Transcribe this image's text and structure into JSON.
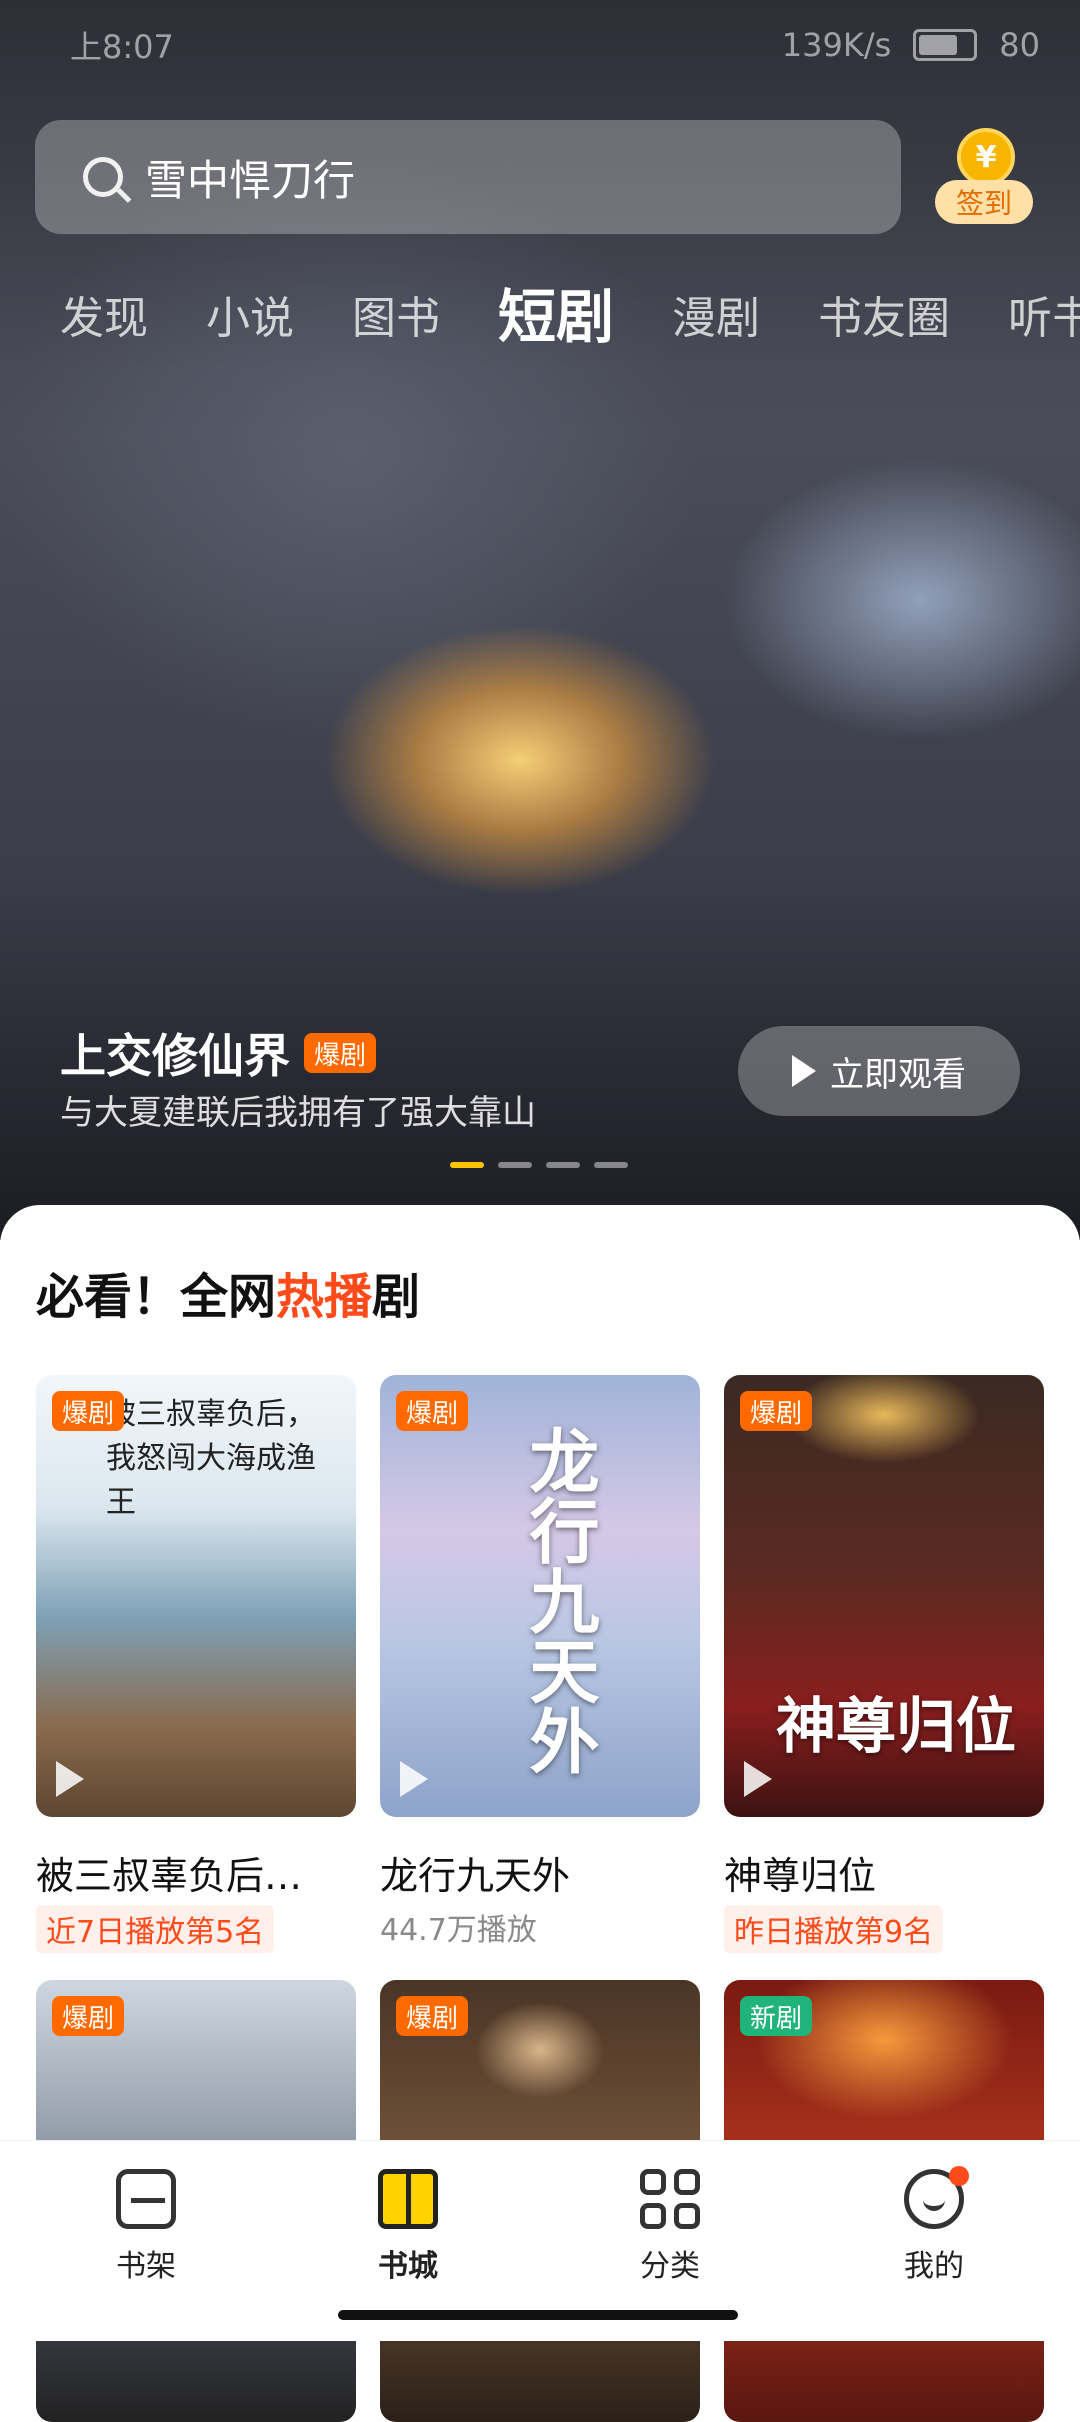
{
  "status_bar": {
    "time": "上8:07",
    "net": "139K/s",
    "battery": "80"
  },
  "search": {
    "placeholder": "雪中悍刀行"
  },
  "checkin": {
    "coin": "¥",
    "label": "签到"
  },
  "tabs": [
    "发现",
    "小说",
    "图书",
    "短剧",
    "漫剧",
    "书友圈",
    "听书"
  ],
  "active_tab": "短剧",
  "hero": {
    "title": "上交修仙界",
    "badge": "爆剧",
    "subtitle": "与大夏建联后我拥有了强大靠山",
    "watch_label": "立即观看"
  },
  "section": {
    "prefix": "必看！全网",
    "hot": "热播",
    "suffix": "剧"
  },
  "cards": [
    {
      "badge": "爆剧",
      "title": "被三叔辜负后…",
      "meta": "近7日播放第5名",
      "art": "被三叔辜负后，我怒闯大海成渔王"
    },
    {
      "badge": "爆剧",
      "title": "龙行九天外",
      "meta": "44.7万播放",
      "art": "龙行九天外"
    },
    {
      "badge": "爆剧",
      "title": "神尊归位",
      "meta": "昨日播放第9名",
      "art": "神尊归位"
    },
    {
      "badge": "爆剧"
    },
    {
      "badge": "爆剧"
    },
    {
      "badge": "新剧"
    }
  ],
  "nav": [
    {
      "label": "书架"
    },
    {
      "label": "书城"
    },
    {
      "label": "分类"
    },
    {
      "label": "我的"
    }
  ],
  "colors": {
    "accent": "#ffd200",
    "hot": "#ff4a1a",
    "badge": "#ff6a00",
    "new_badge": "#20b37a"
  }
}
